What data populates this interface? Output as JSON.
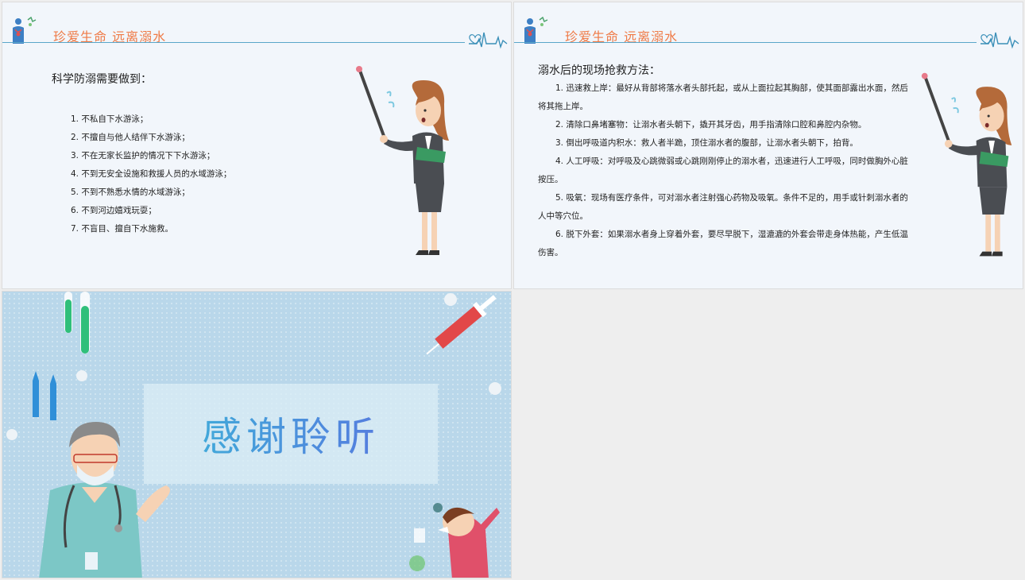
{
  "slides": [
    {
      "header_title": "珍爱生命  远离溺水",
      "heading": "科学防溺需要做到：",
      "items": [
        "1. 不私自下水游泳；",
        "2. 不擅自与他人结伴下水游泳；",
        "3. 不在无家长监护的情况下下水游泳；",
        "4. 不到无安全设施和救援人员的水域游泳；",
        "5. 不到不熟悉水情的水域游泳；",
        "6. 不到河边嬉戏玩耍；",
        "7. 不盲目、擅自下水施救。"
      ]
    },
    {
      "header_title": "珍爱生命  远离溺水",
      "heading": "溺水后的现场抢救方法：",
      "paragraphs": [
        "1. 迅速救上岸：最好从背部将落水者头部托起，或从上面拉起其胸部，使其面部露出水面，然后将其拖上岸。",
        "2. 清除口鼻堵塞物：让溺水者头朝下，撬开其牙齿，用手指清除口腔和鼻腔内杂物。",
        "3. 倒出呼吸道内积水：救人者半跪，顶住溺水者的腹部，让溺水者头朝下，拍背。",
        "4. 人工呼吸：对呼吸及心跳微弱或心跳刚刚停止的溺水者，迅速进行人工呼吸，同时做胸外心脏按压。",
        "5. 吸氧：现场有医疗条件，可对溺水者注射强心药物及吸氧。条件不足的，用手或针刺溺水者的人中等穴位。",
        "6. 脱下外套：如果溺水者身上穿着外套，要尽早脱下，湿漉漉的外套会带走身体热能，产生低温伤害。"
      ]
    },
    {
      "thanks": "感谢聆听"
    }
  ],
  "colors": {
    "header_title": "#ef7a46",
    "header_line": "#5aa6c9",
    "slide_bg": "#f2f6fb",
    "end_bg": "#b9d7ea"
  },
  "icons": [
    "human-body-icon",
    "heartbeat-icon"
  ]
}
